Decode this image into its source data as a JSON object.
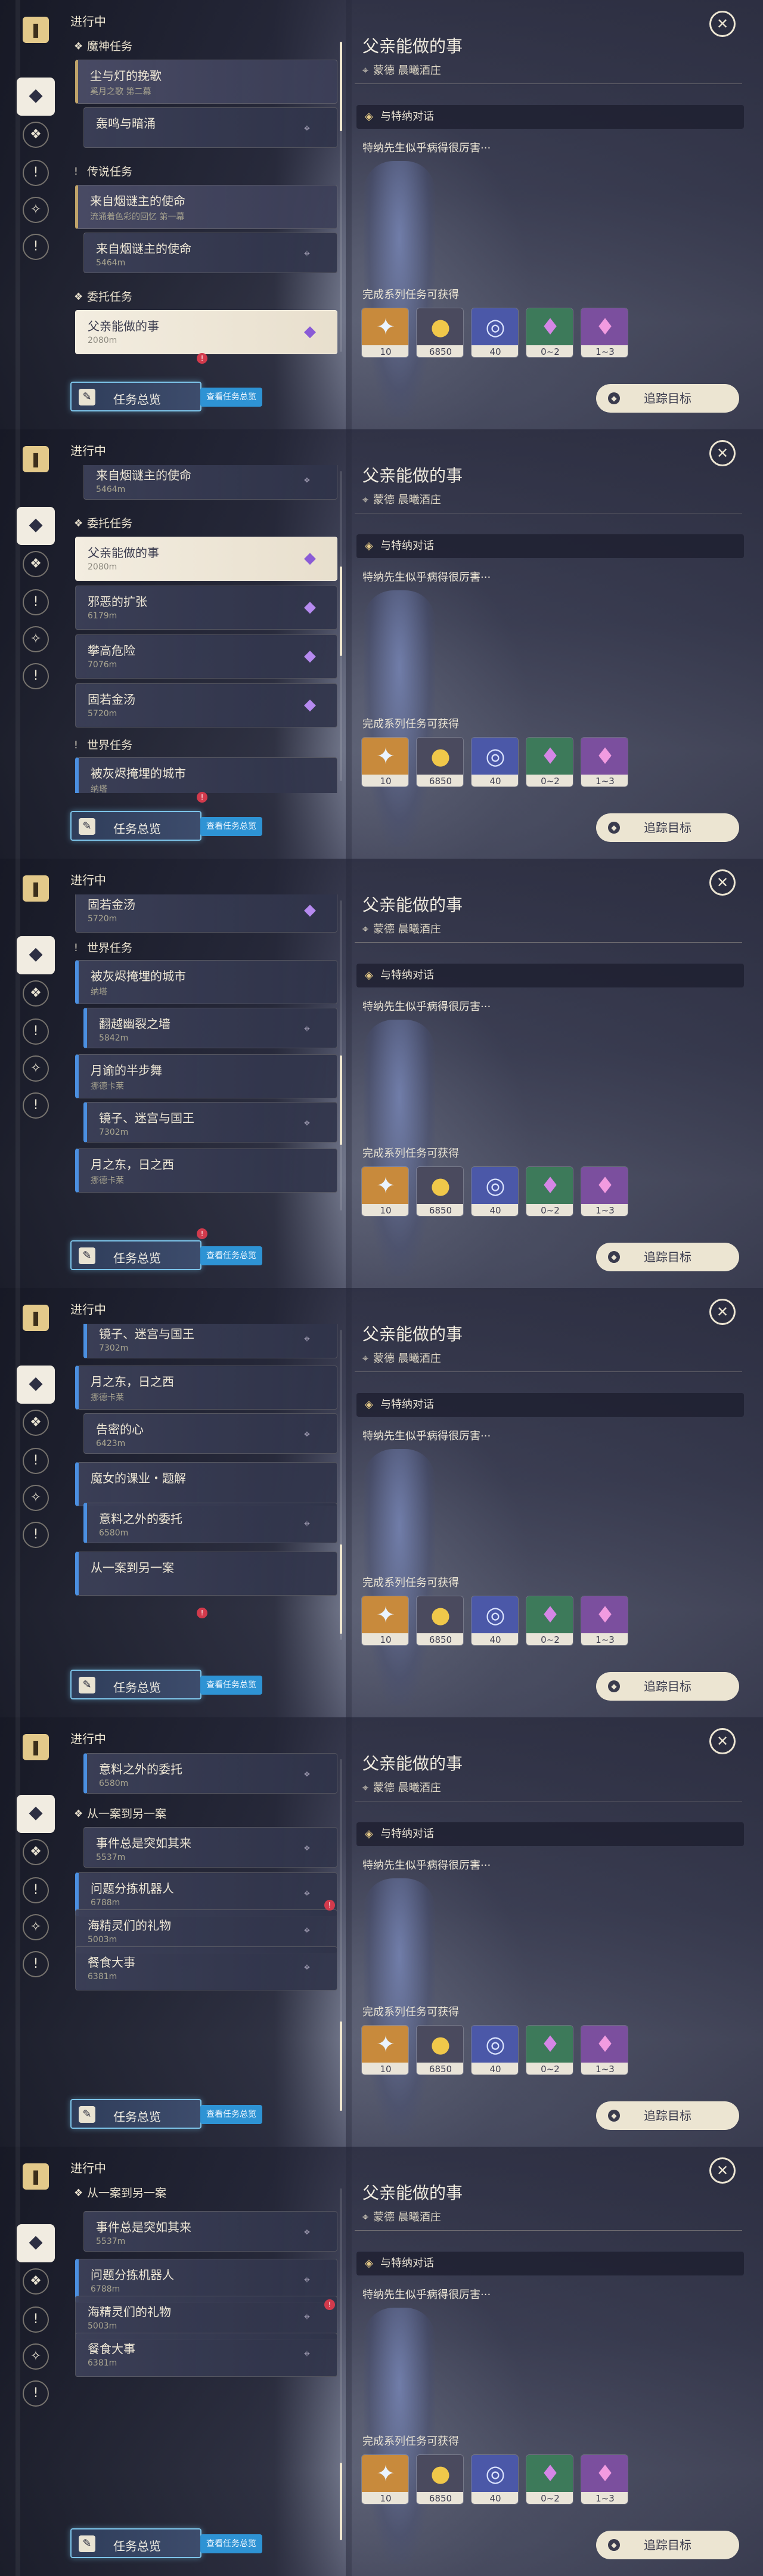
{
  "common": {
    "list_title": "进行中",
    "overview_label": "任务总览",
    "overview_link": "查看任务总览",
    "track_label": "追踪目标",
    "close_glyph": "✕",
    "rail": {
      "book": "❚",
      "buttons": [
        "◆",
        "❖",
        "!",
        "✧",
        "!"
      ]
    }
  },
  "detail": {
    "title": "父亲能做的事",
    "location": "蒙德 晨曦酒庄",
    "objective": "与特纳对话",
    "description": "特纳先生似乎病得很厉害···",
    "rewards_title": "完成系列任务可获得",
    "rewards": [
      {
        "icon": "experience-star-icon",
        "glyph": "✦",
        "count": "10",
        "bg": "#c88a3c",
        "fg": "#eaf4ff"
      },
      {
        "icon": "mora-coin-icon",
        "glyph": "●",
        "count": "6850",
        "bg": "#4a4a5e",
        "fg": "#f0c84a"
      },
      {
        "icon": "adventure-exp-icon",
        "glyph": "◎",
        "count": "40",
        "bg": "#4b58a8",
        "fg": "#dbe3ff"
      },
      {
        "icon": "crystal-green-icon",
        "glyph": "♦",
        "count": "0~2",
        "bg": "#3d7a5a",
        "fg": "#d586e6"
      },
      {
        "icon": "crystal-purple-icon",
        "glyph": "♦",
        "count": "1~3",
        "bg": "#7b4f9e",
        "fg": "#f29be0"
      }
    ]
  },
  "quests": {
    "cat_archon": "魔神任务",
    "cat_legend": "传说任务",
    "cat_commission": "委托任务",
    "cat_world": "世界任务",
    "chenwu_title": "尘与灯的挽歌",
    "chenwu_sub": "奚月之歌 第二幕",
    "jiaming": "轰鸣与暗涌",
    "lairzi_chapter": "来自烟谜主的使命",
    "lairzi_chapter_sub": "流涌着色彩的回忆 第一幕",
    "lairzi_step": "来自烟谜主的使命",
    "lairzi_step_dist": "5464m",
    "fuqin": "父亲能做的事",
    "fuqin_dist": "2080m",
    "xiee": "邪恶的扩张",
    "xiee_dist": "6179m",
    "pangao": "攀高危险",
    "pangao_dist": "7076m",
    "guruo": "固若金汤",
    "guruo_dist": "5720m",
    "huiyan": "被灰烬掩埋的城市",
    "huiyan_sub": "纳塔",
    "fanyue": "翻越幽裂之墙",
    "fanyue_dist": "5842m",
    "yueyu": "月谕的半步舞",
    "yueyu_sub": "挪德卡莱",
    "jingzi": "镜子、迷宫与国王",
    "jingzi_dist": "7302m",
    "yuezhidong": "月之东，日之西",
    "yuezhidong_sub": "挪德卡莱",
    "gaomi": "告密的心",
    "gaomi_dist": "6423m",
    "monv": "魔女的课业・题解",
    "yiliao": "意料之外的委托",
    "yiliao_dist": "6580m",
    "congyi": "从一案到另一案",
    "shijian": "事件总是突如其来",
    "shijian_dist": "5537m",
    "wenti": "问题分拣机器人",
    "wenti_dist": "6788m",
    "haijing": "海精灵们的礼物",
    "haijing_dist": "5003m",
    "canshi": "餐食大事",
    "canshi_dist": "6381m"
  }
}
